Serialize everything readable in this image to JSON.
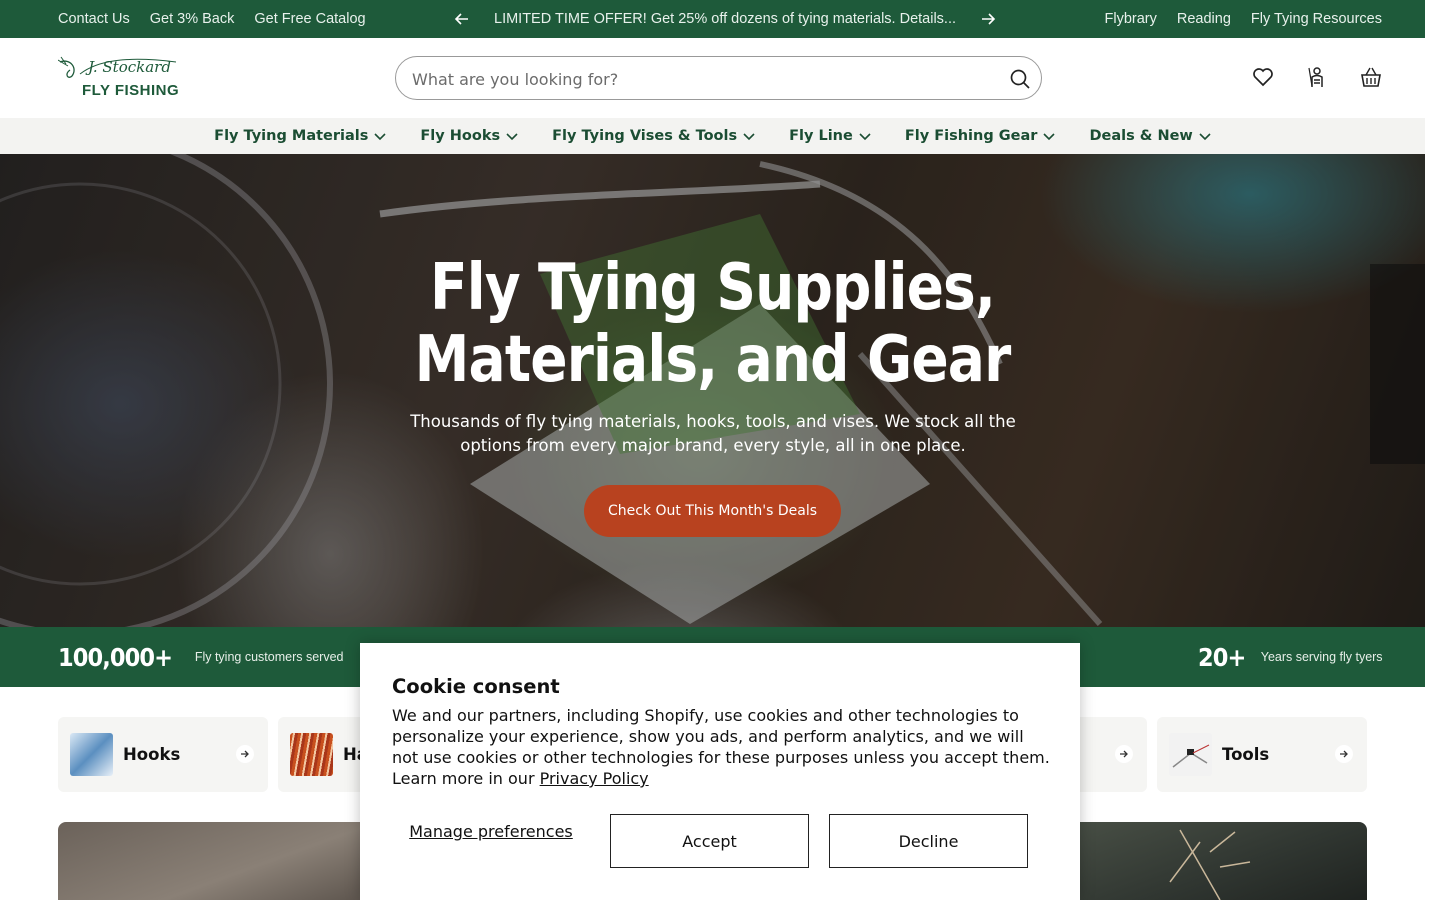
{
  "topbar": {
    "left_links": [
      "Contact Us",
      "Get 3% Back",
      "Get Free Catalog"
    ],
    "announcement": "LIMITED TIME OFFER! Get 25% off dozens of tying materials. Details...",
    "right_links": [
      "Flybrary",
      "Reading",
      "Fly Tying Resources"
    ]
  },
  "header": {
    "logo_script": "J. Stockard",
    "logo_text": "FLY FISHING",
    "search_placeholder": "What are you looking for?"
  },
  "nav": {
    "items": [
      "Fly Tying Materials",
      "Fly Hooks",
      "Fly Tying Vises & Tools",
      "Fly Line",
      "Fly Fishing Gear",
      "Deals & New"
    ]
  },
  "hero": {
    "title_line1": "Fly Tying Supplies,",
    "title_line2": "Materials, and Gear",
    "subtitle": "Thousands of fly tying materials, hooks, tools, and vises. We stock all the options from every major brand, every style, all in one place.",
    "cta": "Check Out This Month's Deals"
  },
  "stats": [
    {
      "num": "100,000+",
      "label": "Fly tying customers served"
    },
    {
      "num": "20+",
      "label": "Years serving fly tyers"
    }
  ],
  "categories": [
    {
      "name": "Hooks"
    },
    {
      "name": "Ha"
    },
    {
      "name": "Tools"
    }
  ],
  "cookie": {
    "title": "Cookie consent",
    "body": "We and our partners, including Shopify, use cookies and other technologies to personalize your experience, show you ads, and perform analytics, and we will not use cookies or other technologies for these purposes unless you accept them. Learn more in our",
    "policy_link": "Privacy Policy",
    "manage": "Manage preferences",
    "accept": "Accept",
    "decline": "Decline"
  },
  "colors": {
    "brand_green": "#1e5a3a",
    "nav_text": "#1b4d33",
    "cta_orange": "#b8421f"
  }
}
